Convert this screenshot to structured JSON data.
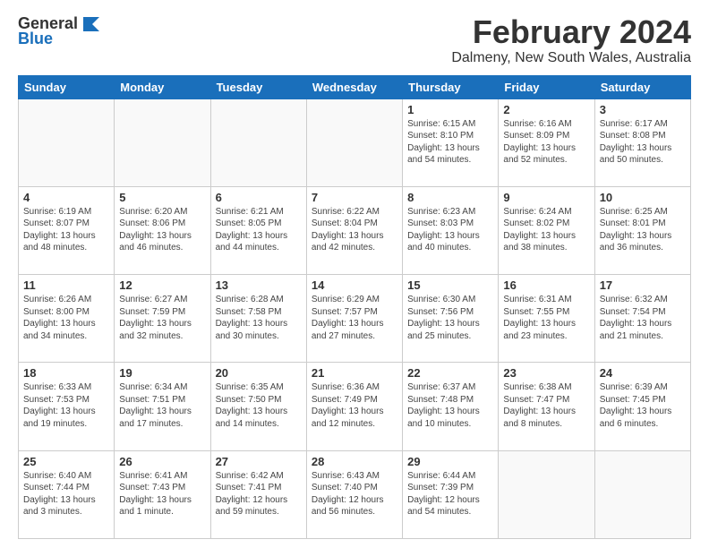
{
  "logo": {
    "general": "General",
    "blue": "Blue"
  },
  "title": "February 2024",
  "subtitle": "Dalmeny, New South Wales, Australia",
  "days_of_week": [
    "Sunday",
    "Monday",
    "Tuesday",
    "Wednesday",
    "Thursday",
    "Friday",
    "Saturday"
  ],
  "weeks": [
    [
      {
        "day": "",
        "info": ""
      },
      {
        "day": "",
        "info": ""
      },
      {
        "day": "",
        "info": ""
      },
      {
        "day": "",
        "info": ""
      },
      {
        "day": "1",
        "info": "Sunrise: 6:15 AM\nSunset: 8:10 PM\nDaylight: 13 hours\nand 54 minutes."
      },
      {
        "day": "2",
        "info": "Sunrise: 6:16 AM\nSunset: 8:09 PM\nDaylight: 13 hours\nand 52 minutes."
      },
      {
        "day": "3",
        "info": "Sunrise: 6:17 AM\nSunset: 8:08 PM\nDaylight: 13 hours\nand 50 minutes."
      }
    ],
    [
      {
        "day": "4",
        "info": "Sunrise: 6:19 AM\nSunset: 8:07 PM\nDaylight: 13 hours\nand 48 minutes."
      },
      {
        "day": "5",
        "info": "Sunrise: 6:20 AM\nSunset: 8:06 PM\nDaylight: 13 hours\nand 46 minutes."
      },
      {
        "day": "6",
        "info": "Sunrise: 6:21 AM\nSunset: 8:05 PM\nDaylight: 13 hours\nand 44 minutes."
      },
      {
        "day": "7",
        "info": "Sunrise: 6:22 AM\nSunset: 8:04 PM\nDaylight: 13 hours\nand 42 minutes."
      },
      {
        "day": "8",
        "info": "Sunrise: 6:23 AM\nSunset: 8:03 PM\nDaylight: 13 hours\nand 40 minutes."
      },
      {
        "day": "9",
        "info": "Sunrise: 6:24 AM\nSunset: 8:02 PM\nDaylight: 13 hours\nand 38 minutes."
      },
      {
        "day": "10",
        "info": "Sunrise: 6:25 AM\nSunset: 8:01 PM\nDaylight: 13 hours\nand 36 minutes."
      }
    ],
    [
      {
        "day": "11",
        "info": "Sunrise: 6:26 AM\nSunset: 8:00 PM\nDaylight: 13 hours\nand 34 minutes."
      },
      {
        "day": "12",
        "info": "Sunrise: 6:27 AM\nSunset: 7:59 PM\nDaylight: 13 hours\nand 32 minutes."
      },
      {
        "day": "13",
        "info": "Sunrise: 6:28 AM\nSunset: 7:58 PM\nDaylight: 13 hours\nand 30 minutes."
      },
      {
        "day": "14",
        "info": "Sunrise: 6:29 AM\nSunset: 7:57 PM\nDaylight: 13 hours\nand 27 minutes."
      },
      {
        "day": "15",
        "info": "Sunrise: 6:30 AM\nSunset: 7:56 PM\nDaylight: 13 hours\nand 25 minutes."
      },
      {
        "day": "16",
        "info": "Sunrise: 6:31 AM\nSunset: 7:55 PM\nDaylight: 13 hours\nand 23 minutes."
      },
      {
        "day": "17",
        "info": "Sunrise: 6:32 AM\nSunset: 7:54 PM\nDaylight: 13 hours\nand 21 minutes."
      }
    ],
    [
      {
        "day": "18",
        "info": "Sunrise: 6:33 AM\nSunset: 7:53 PM\nDaylight: 13 hours\nand 19 minutes."
      },
      {
        "day": "19",
        "info": "Sunrise: 6:34 AM\nSunset: 7:51 PM\nDaylight: 13 hours\nand 17 minutes."
      },
      {
        "day": "20",
        "info": "Sunrise: 6:35 AM\nSunset: 7:50 PM\nDaylight: 13 hours\nand 14 minutes."
      },
      {
        "day": "21",
        "info": "Sunrise: 6:36 AM\nSunset: 7:49 PM\nDaylight: 13 hours\nand 12 minutes."
      },
      {
        "day": "22",
        "info": "Sunrise: 6:37 AM\nSunset: 7:48 PM\nDaylight: 13 hours\nand 10 minutes."
      },
      {
        "day": "23",
        "info": "Sunrise: 6:38 AM\nSunset: 7:47 PM\nDaylight: 13 hours\nand 8 minutes."
      },
      {
        "day": "24",
        "info": "Sunrise: 6:39 AM\nSunset: 7:45 PM\nDaylight: 13 hours\nand 6 minutes."
      }
    ],
    [
      {
        "day": "25",
        "info": "Sunrise: 6:40 AM\nSunset: 7:44 PM\nDaylight: 13 hours\nand 3 minutes."
      },
      {
        "day": "26",
        "info": "Sunrise: 6:41 AM\nSunset: 7:43 PM\nDaylight: 13 hours\nand 1 minute."
      },
      {
        "day": "27",
        "info": "Sunrise: 6:42 AM\nSunset: 7:41 PM\nDaylight: 12 hours\nand 59 minutes."
      },
      {
        "day": "28",
        "info": "Sunrise: 6:43 AM\nSunset: 7:40 PM\nDaylight: 12 hours\nand 56 minutes."
      },
      {
        "day": "29",
        "info": "Sunrise: 6:44 AM\nSunset: 7:39 PM\nDaylight: 12 hours\nand 54 minutes."
      },
      {
        "day": "",
        "info": ""
      },
      {
        "day": "",
        "info": ""
      }
    ]
  ]
}
